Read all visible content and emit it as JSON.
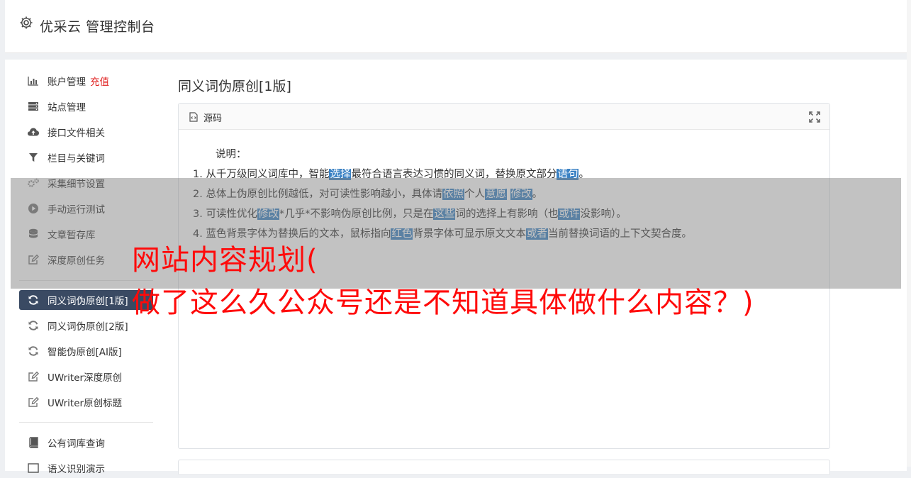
{
  "header": {
    "title": "优采云 管理控制台",
    "icon": "gear-icon"
  },
  "sidebar": {
    "items": [
      {
        "label": "账户管理",
        "badge": "充值",
        "icon": "bar-chart-icon"
      },
      {
        "label": "站点管理",
        "icon": "server-icon"
      },
      {
        "label": "接口文件相关",
        "icon": "cloud-upload-icon"
      },
      {
        "label": "栏目与关键词",
        "icon": "filter-icon"
      },
      {
        "label": "采集细节设置",
        "icon": "gears-icon"
      },
      {
        "label": "手动运行测试",
        "icon": "play-circle-icon"
      },
      {
        "label": "文章暂存库",
        "icon": "database-icon"
      },
      {
        "label": "深度原创任务",
        "icon": "edit-icon"
      },
      {
        "label": "同义词伪原创[1版]",
        "icon": "refresh-icon",
        "active": true
      },
      {
        "label": "同义词伪原创[2版]",
        "icon": "refresh-icon"
      },
      {
        "label": "智能伪原创[AI版]",
        "icon": "refresh-icon"
      },
      {
        "label": "UWriter深度原创",
        "icon": "edit-icon"
      },
      {
        "label": "UWriter原创标题",
        "icon": "edit-icon"
      },
      {
        "label": "公有词库查询",
        "icon": "book-icon"
      },
      {
        "label": "语义识别演示",
        "icon": "list-icon"
      }
    ]
  },
  "main": {
    "title": "同义词伪原创[1版]",
    "card_label": "源码",
    "desc_head": "说明：",
    "lines": [
      {
        "parts": [
          {
            "t": "1. 从千万级同义词库中，智能"
          },
          {
            "t": "选择",
            "hl": true
          },
          {
            "t": "最符合语言表达习惯的同义词，替换原文部分"
          },
          {
            "t": "语句",
            "hl": true
          },
          {
            "t": "。"
          }
        ]
      },
      {
        "parts": [
          {
            "t": "2. 总体上伪原创比例越低，对可读性影响越小，具体请"
          },
          {
            "t": "依照",
            "hl": true
          },
          {
            "t": "个人"
          },
          {
            "t": "意愿",
            "hl": true
          },
          {
            "t": " "
          },
          {
            "t": "修改",
            "hl": true
          },
          {
            "t": "。"
          }
        ]
      },
      {
        "parts": [
          {
            "t": "3. 可读性优化"
          },
          {
            "t": "修改",
            "hl": true
          },
          {
            "t": "*几乎*不影响伪原创比例，只是在"
          },
          {
            "t": "这些",
            "hl": true
          },
          {
            "t": "词的选择上有影响（也"
          },
          {
            "t": "或许",
            "hl": true
          },
          {
            "t": "没影响）。"
          }
        ]
      },
      {
        "parts": [
          {
            "t": "4. 蓝色背景字体为替换后的文本，鼠标指向"
          },
          {
            "t": "红色",
            "hl": true
          },
          {
            "t": "背景字体可显示原文文本"
          },
          {
            "t": "或者",
            "hl": true
          },
          {
            "t": "当前替换词语的上下文契合度。"
          }
        ]
      }
    ]
  },
  "overlay": {
    "line1": "网站内容规划(",
    "line2": "做了这么久公众号还是不知道具体做什么内容？)",
    "color": "#ff0a0a"
  },
  "colors": {
    "active_nav": "#3a4a63",
    "highlight": "#3b82c4",
    "recharge": "#e02020"
  }
}
